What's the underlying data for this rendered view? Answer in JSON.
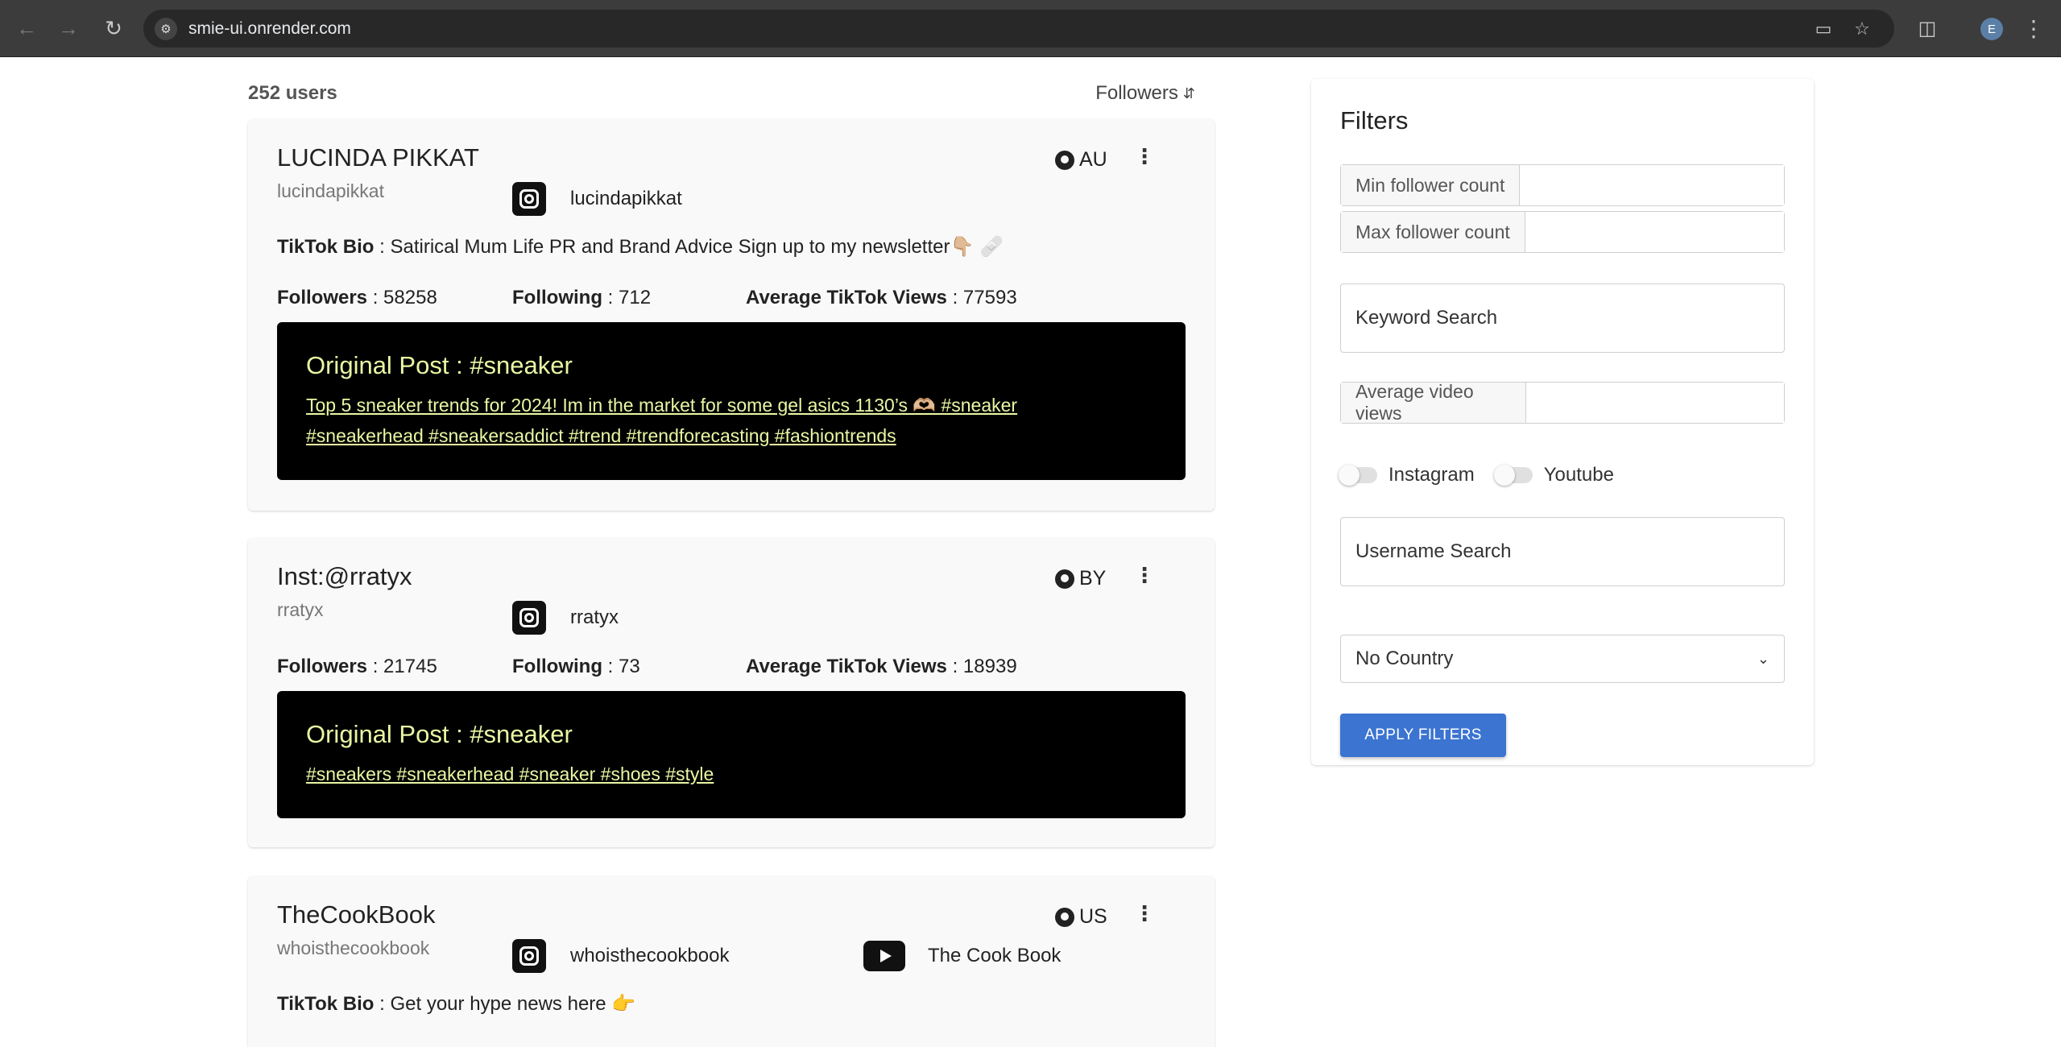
{
  "browser": {
    "url": "smie-ui.onrender.com",
    "back_icon": "arrow-left-icon",
    "forward_icon": "arrow-right-icon",
    "reload_icon": "reload-icon",
    "profile_initial": "E"
  },
  "list": {
    "user_count": "252 users",
    "sort_label": "Followers"
  },
  "cards": [
    {
      "name": "LUCINDA  PIKKAT",
      "handle": "lucindapikkat",
      "country": "AU",
      "instagram": "lucindapikkat",
      "bio_label": "TikTok Bio",
      "bio_sep": " : ",
      "bio": "Satirical Mum Life PR and Brand Advice Sign up to my newsletter👇🏼 🩹",
      "followers_label": "Followers",
      "followers": "58258",
      "following_label": "Following",
      "following": "712",
      "views_label": "Average TikTok Views",
      "views": "77593",
      "post_title": "Original Post : #sneaker",
      "post_text": "Top 5 sneaker trends for 2024! Im in the market for some gel asics 1130’s 🫶🏼 #sneaker #sneakerhead #sneakersaddict #trend #trendforecasting #fashiontrends"
    },
    {
      "name": "Inst:@rratyx",
      "handle": "rratyx",
      "country": "BY",
      "instagram": "rratyx",
      "followers_label": "Followers",
      "followers": "21745",
      "following_label": "Following",
      "following": "73",
      "views_label": "Average TikTok Views",
      "views": "18939",
      "post_title": "Original Post : #sneaker",
      "post_text": "#sneakers #sneakerhead #sneaker #shoes #style"
    },
    {
      "name": "TheCookBook",
      "handle": "whoisthecookbook",
      "country": "US",
      "instagram": "whoisthecookbook",
      "youtube": "The Cook Book",
      "bio_label": "TikTok Bio",
      "bio_sep": " : ",
      "bio": "Get your hype news here 👉"
    }
  ],
  "filters": {
    "title": "Filters",
    "min_follower_label": "Min follower count",
    "max_follower_label": "Max follower count",
    "keyword_placeholder": "Keyword Search",
    "avg_views_label": "Average video views",
    "instagram_toggle": "Instagram",
    "youtube_toggle": "Youtube",
    "username_placeholder": "Username Search",
    "country_selected": "No Country",
    "apply_button": "APPLY FILTERS"
  }
}
